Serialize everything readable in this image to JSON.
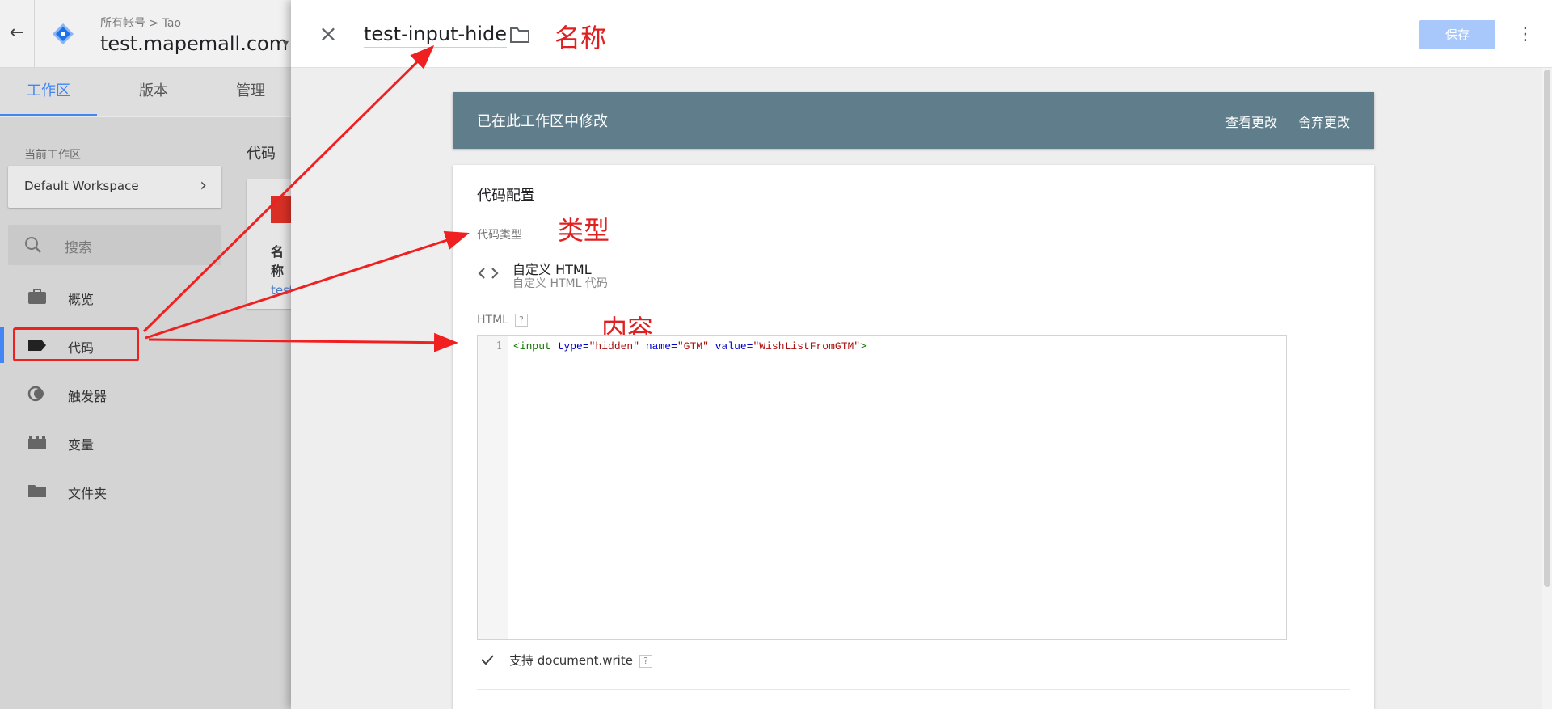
{
  "header": {
    "breadcrumb": "所有帐号 > Tao",
    "container": "test.mapemall.com",
    "caret": "▾"
  },
  "tabs": [
    {
      "label": "工作区",
      "active": true
    },
    {
      "label": "版本",
      "active": false
    },
    {
      "label": "管理",
      "active": false
    }
  ],
  "sidebar": {
    "workspace_label": "当前工作区",
    "workspace_name": "Default Workspace",
    "search_placeholder": "搜索",
    "items": [
      {
        "label": "概览",
        "icon": "briefcase-icon"
      },
      {
        "label": "代码",
        "icon": "tag-icon",
        "active": true
      },
      {
        "label": "触发器",
        "icon": "trigger-icon"
      },
      {
        "label": "变量",
        "icon": "variable-icon"
      },
      {
        "label": "文件夹",
        "icon": "folder-icon"
      }
    ]
  },
  "content": {
    "title": "代码",
    "col_head": "名称",
    "row_link": "test"
  },
  "panel": {
    "tag_name": "test-input-hide",
    "save_label": "保存",
    "notice": {
      "text": "已在此工作区中修改",
      "view_changes": "查看更改",
      "discard_changes": "舍弃更改"
    },
    "config": {
      "title": "代码配置",
      "type_label": "代码类型",
      "type_name": "自定义 HTML",
      "type_desc": "自定义 HTML 代码",
      "html_label": "HTML",
      "help": "?",
      "line_number": "1",
      "code": {
        "open": "<input",
        "attr1": " type=",
        "val1": "\"hidden\"",
        "attr2": " name=",
        "val2": "\"GTM\"",
        "attr3": " value=",
        "val3": "\"WishListFromGTM\"",
        "close": ">"
      },
      "document_write_label": "支持 document.write"
    }
  },
  "annotations": {
    "name": "名称",
    "type": "类型",
    "content": "内容",
    "color": "#e02020"
  },
  "colors": {
    "accent": "#4285f4",
    "notice_bg": "#607d8b",
    "save_disabled": "#a8c7fa"
  }
}
